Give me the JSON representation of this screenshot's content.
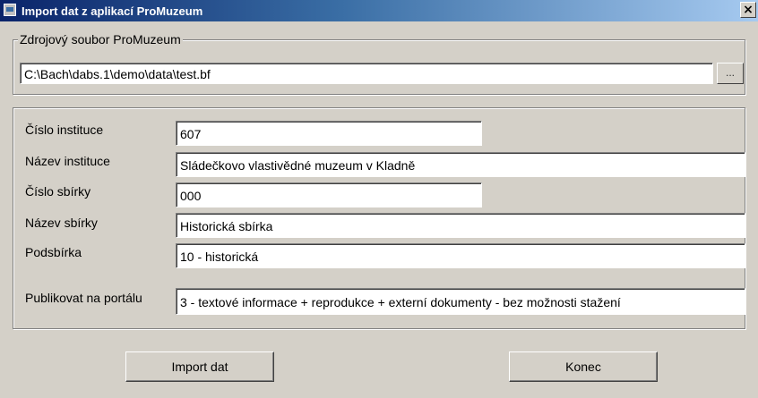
{
  "window": {
    "title": "Import dat z aplikací ProMuzeum",
    "close_label": "×"
  },
  "source": {
    "legend": "Zdrojový soubor ProMuzeum",
    "path": "C:\\Bach\\dabs.1\\demo\\data\\test.bf",
    "browse_label": "..."
  },
  "fields": {
    "cislo_instituce": {
      "label": "Číslo instituce",
      "value": "607"
    },
    "nazev_instituce": {
      "label": "Název instituce",
      "value": "Sládečkovo vlastivědné muzeum v Kladně"
    },
    "cislo_sbirky": {
      "label": "Číslo sbírky",
      "value": "000"
    },
    "nazev_sbirky": {
      "label": "Název sbírky",
      "value": "Historická sbírka"
    },
    "podsbirka": {
      "label": "Podsbírka",
      "value": "10 - historická"
    },
    "publikovat": {
      "label": "Publikovat na portálu",
      "value": "3 - textové informace + reprodukce + externí dokumenty - bez možnosti stažení"
    }
  },
  "buttons": {
    "import_label": "Import dat",
    "close_label": "Konec"
  }
}
